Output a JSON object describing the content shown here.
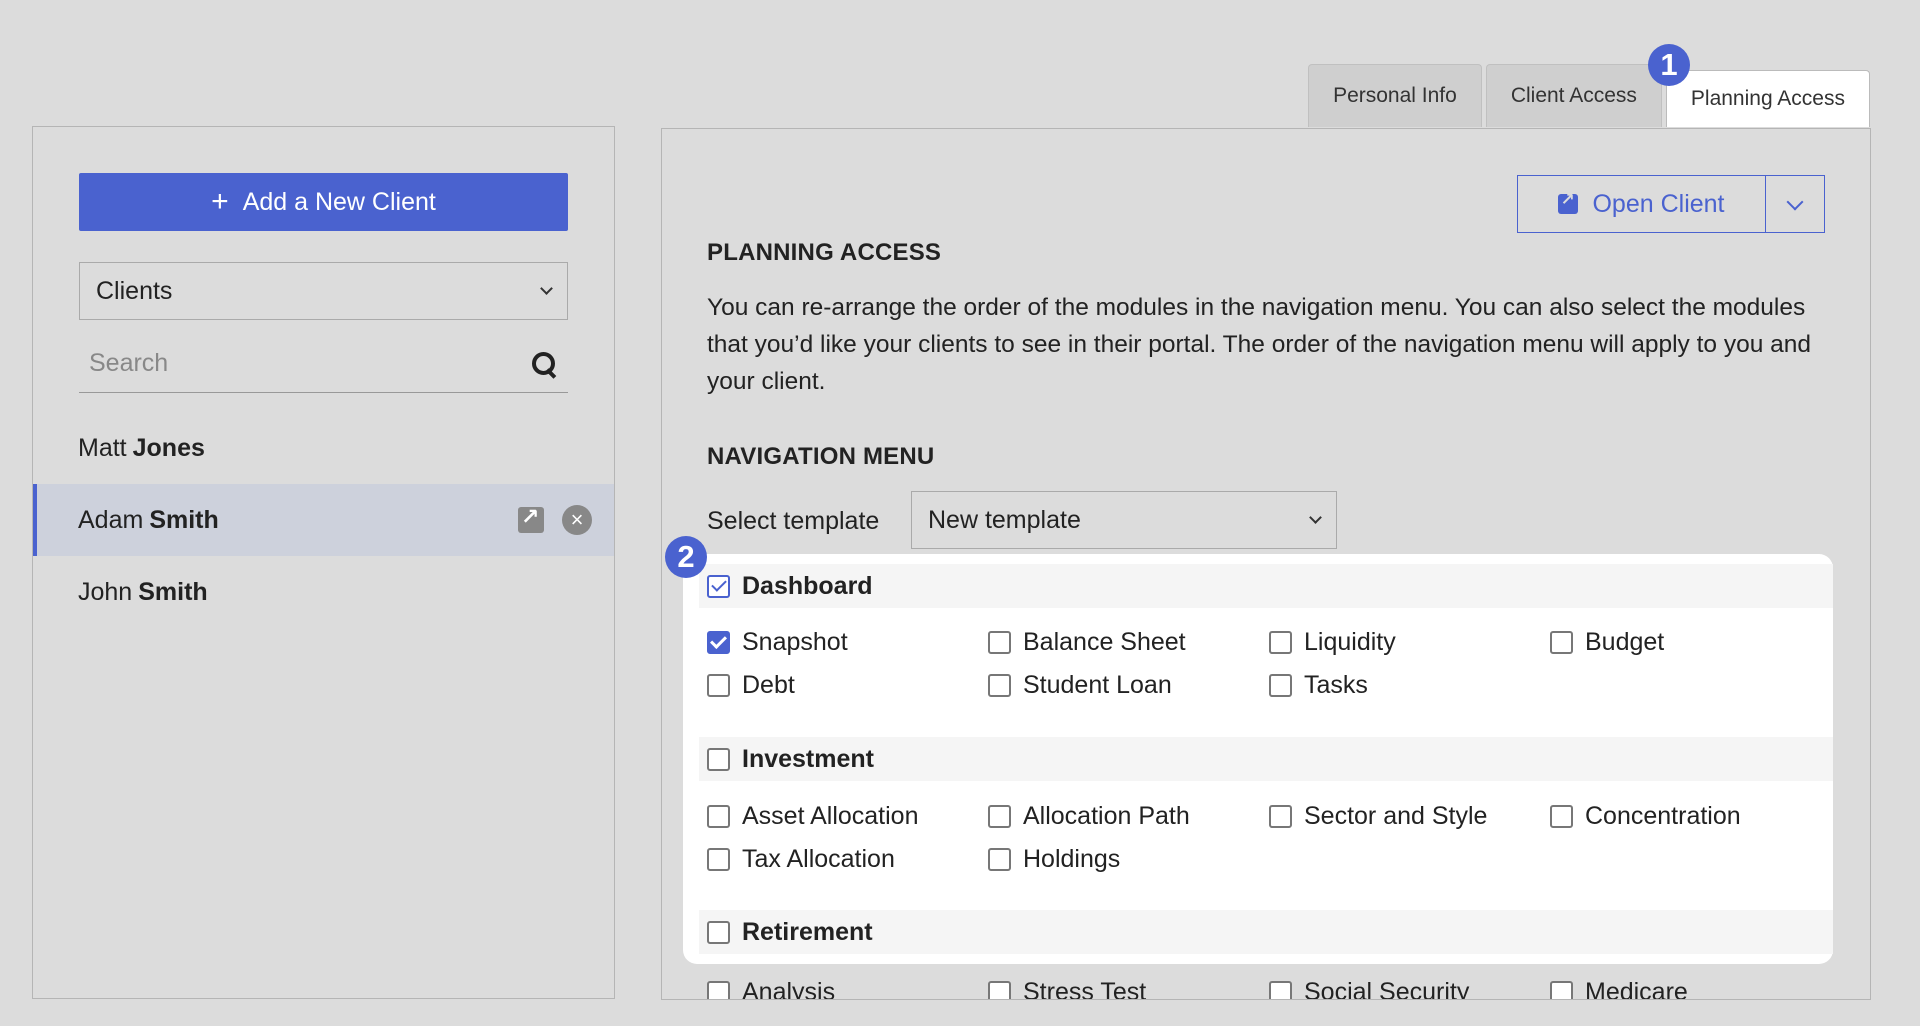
{
  "sidebar": {
    "add_button": "Add a New Client",
    "filter_select": "Clients",
    "search_placeholder": "Search",
    "clients": [
      {
        "first": "Matt",
        "last": "Jones",
        "active": false
      },
      {
        "first": "Adam",
        "last": "Smith",
        "active": true
      },
      {
        "first": "John",
        "last": "Smith",
        "active": false
      }
    ]
  },
  "tabs": [
    {
      "label": "Personal Info"
    },
    {
      "label": "Client Access"
    },
    {
      "label": "Planning Access"
    }
  ],
  "badges": {
    "tabs": "1",
    "modules": "2"
  },
  "main": {
    "open_client": "Open Client",
    "planning_title": "PLANNING ACCESS",
    "description": "You can re-arrange the order of the modules in the navigation menu. You can also select the modules that you’d like your clients to see in their portal. The order of the navigation menu will apply to you and your client.",
    "nav_title": "NAVIGATION MENU",
    "template_label": "Select template",
    "template_value": "New template"
  },
  "groups": [
    {
      "name": "Dashboard",
      "checked": true,
      "items": [
        {
          "label": "Snapshot",
          "checked": true
        },
        {
          "label": "Balance Sheet",
          "checked": false
        },
        {
          "label": "Liquidity",
          "checked": false
        },
        {
          "label": "Budget",
          "checked": false
        },
        {
          "label": "Debt",
          "checked": false
        },
        {
          "label": "Student Loan",
          "checked": false
        },
        {
          "label": "Tasks",
          "checked": false
        }
      ]
    },
    {
      "name": "Investment",
      "checked": false,
      "items": [
        {
          "label": "Asset Allocation",
          "checked": false
        },
        {
          "label": "Allocation Path",
          "checked": false
        },
        {
          "label": "Sector and Style",
          "checked": false
        },
        {
          "label": "Concentration",
          "checked": false
        },
        {
          "label": "Tax Allocation",
          "checked": false
        },
        {
          "label": "Holdings",
          "checked": false
        }
      ]
    },
    {
      "name": "Retirement",
      "checked": false,
      "items": [
        {
          "label": "Analysis",
          "checked": false
        },
        {
          "label": "Stress Test",
          "checked": false
        },
        {
          "label": "Social Security",
          "checked": false
        },
        {
          "label": "Medicare",
          "checked": false
        }
      ]
    }
  ],
  "colors": {
    "accent": "#4a62cf",
    "background": "#dcdcdc"
  }
}
